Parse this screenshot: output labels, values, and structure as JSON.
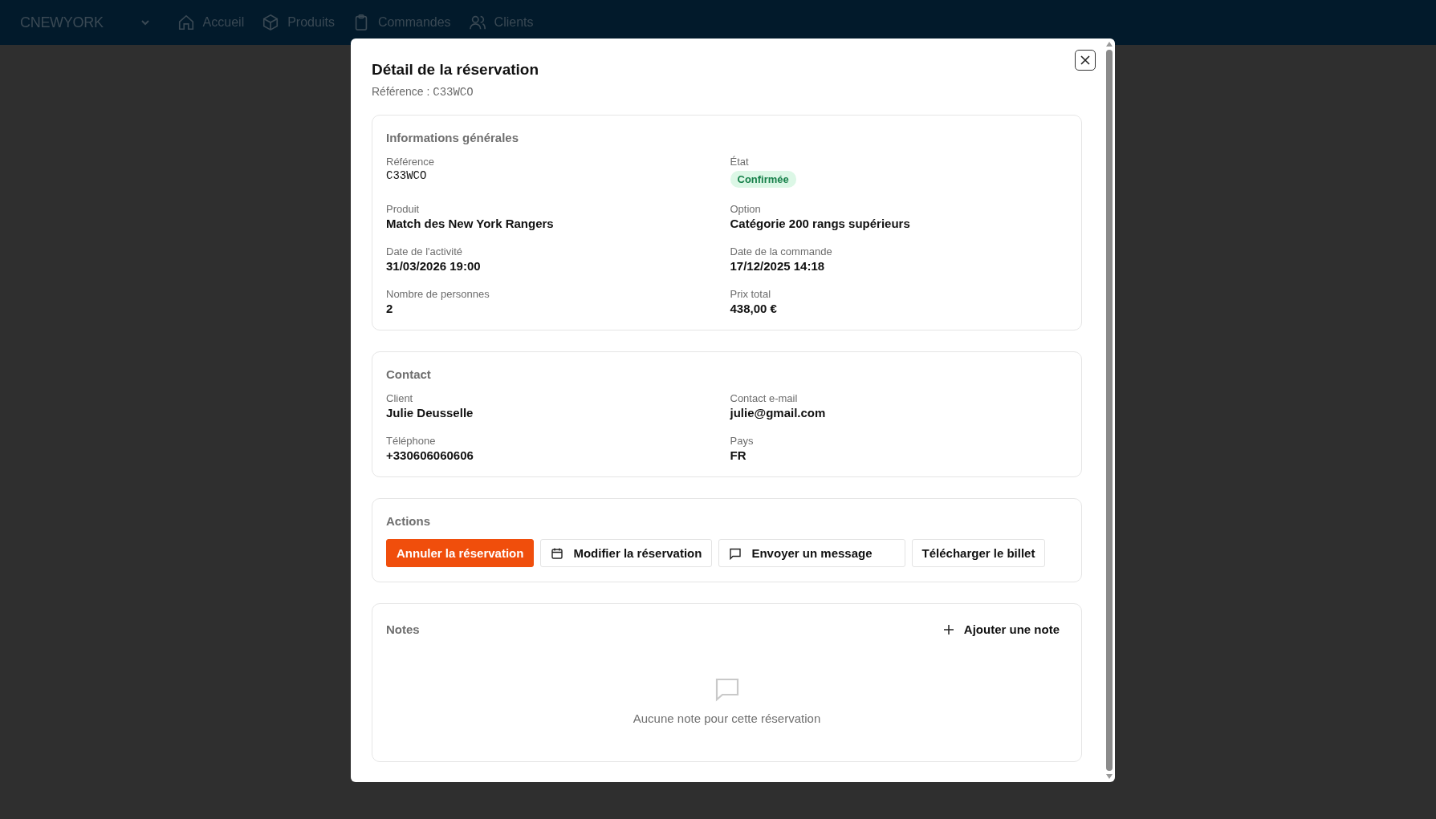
{
  "navbar": {
    "brand": "CNEWYORK",
    "items": [
      {
        "label": "Accueil",
        "kind": "home"
      },
      {
        "label": "Produits",
        "kind": "box"
      },
      {
        "label": "Commandes",
        "kind": "clipboard"
      },
      {
        "label": "Clients",
        "kind": "users"
      }
    ]
  },
  "modal": {
    "title": "Détail de la réservation",
    "subtitle_label": "Référence :",
    "subtitle_code": "C33WCO",
    "sections": [
      {
        "kind": "fields",
        "title": "Informations générales",
        "fields": [
          {
            "label": "Référence",
            "value": "C33WCO",
            "kind": "mono"
          },
          {
            "label": "État",
            "value": "Confirmée",
            "kind": "badge"
          },
          {
            "label": "Produit",
            "value": "Match des New York Rangers",
            "kind": "text"
          },
          {
            "label": "Option",
            "value": "Catégorie 200 rangs supérieurs",
            "kind": "text"
          },
          {
            "label": "Date de l'activité",
            "value": "31/03/2026 19:00",
            "kind": "text"
          },
          {
            "label": "Date de la commande",
            "value": "17/12/2025 14:18",
            "kind": "text"
          },
          {
            "label": "Nombre de personnes",
            "value": "2",
            "kind": "text"
          },
          {
            "label": "Prix total",
            "value": "438,00 €",
            "kind": "text"
          }
        ]
      },
      {
        "kind": "fields",
        "title": "Contact",
        "fields": [
          {
            "label": "Client",
            "value": "Julie Deusselle",
            "kind": "text"
          },
          {
            "label": "Contact e-mail",
            "value": "julie@gmail.com",
            "kind": "text"
          },
          {
            "label": "Téléphone",
            "value": "+330606060606",
            "kind": "text"
          },
          {
            "label": "Pays",
            "value": "FR",
            "kind": "text"
          }
        ]
      },
      {
        "kind": "actions",
        "title": "Actions",
        "buttons": [
          {
            "label": "Annuler la réservation",
            "kind": "danger"
          },
          {
            "label": "Modifier la réservation",
            "kind": "calendar"
          },
          {
            "label": "Envoyer un message",
            "kind": "message"
          },
          {
            "label": "Télécharger le billet",
            "kind": "plain"
          }
        ]
      },
      {
        "kind": "notes",
        "title": "Notes",
        "add_label": "Ajouter une note",
        "empty_text": "Aucune note pour cette réservation"
      }
    ]
  }
}
